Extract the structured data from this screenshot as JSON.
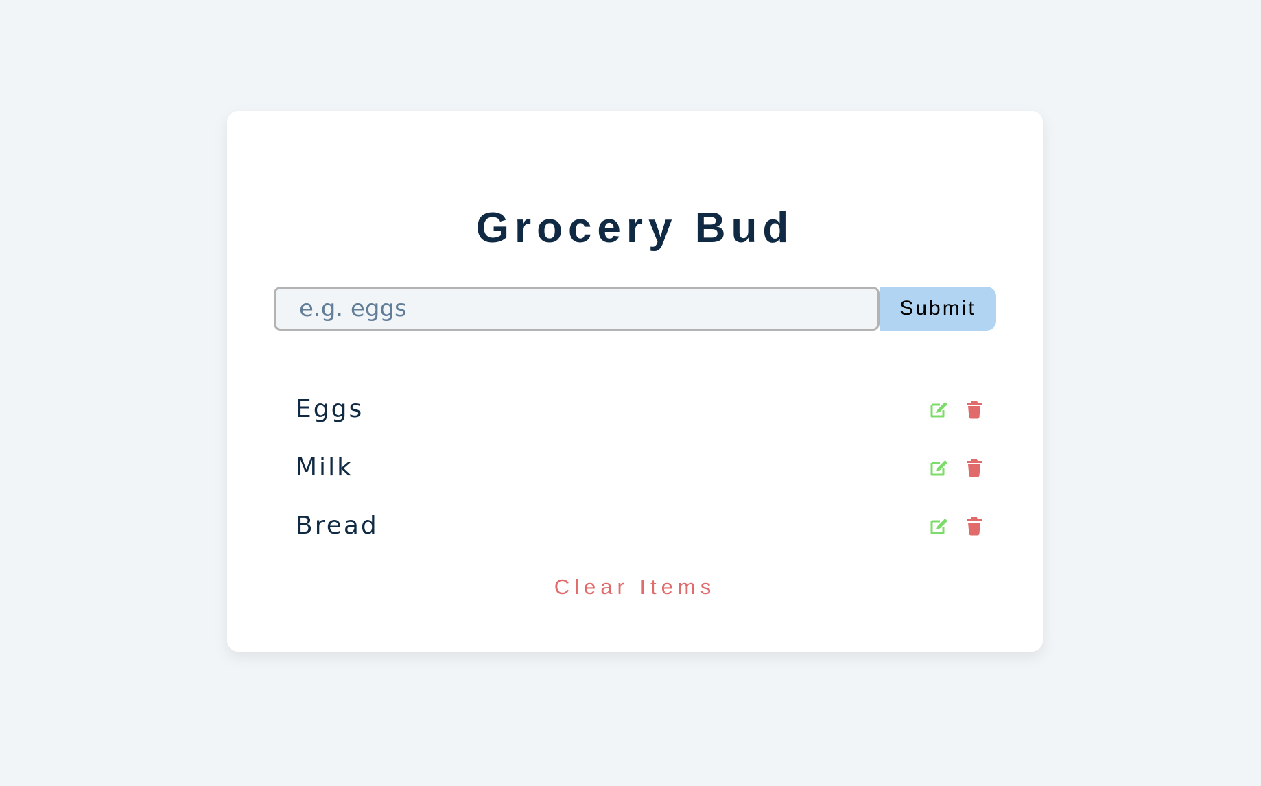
{
  "app": {
    "title": "Grocery Bud"
  },
  "form": {
    "placeholder": "e.g. eggs",
    "value": "",
    "submit_label": "Submit"
  },
  "items": [
    {
      "name": "Eggs"
    },
    {
      "name": "Milk"
    },
    {
      "name": "Bread"
    }
  ],
  "clear_label": "Clear Items",
  "icons": {
    "edit": "edit-icon",
    "delete": "trash-icon"
  },
  "colors": {
    "background": "#f1f5f8",
    "title": "#102a43",
    "submit_bg": "#b1d4f3",
    "edit_icon": "#7cdc6a",
    "delete_icon": "#e16b6b",
    "clear_text": "#e16b6b"
  }
}
